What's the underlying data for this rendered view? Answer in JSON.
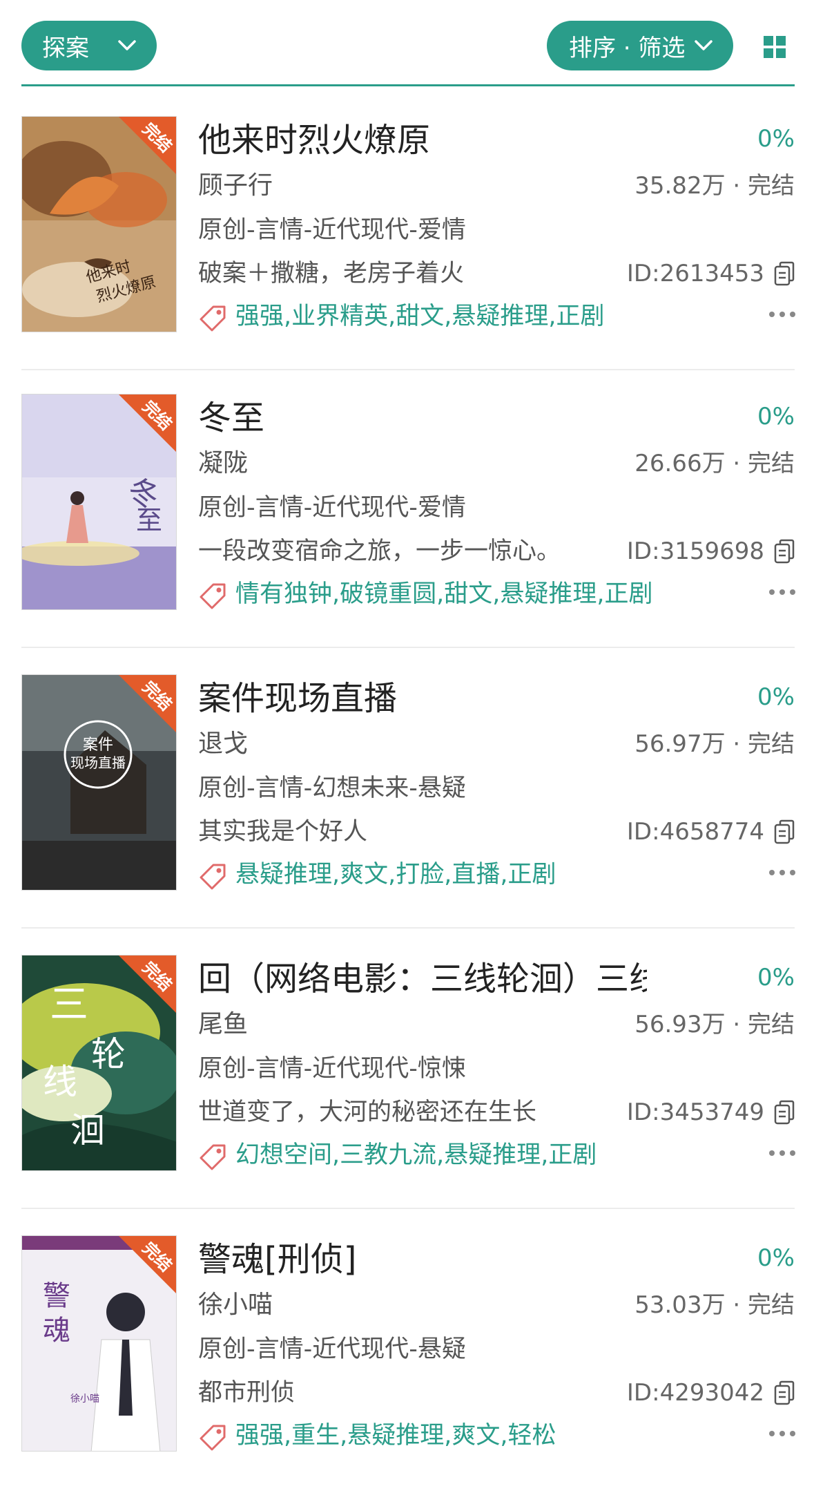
{
  "header": {
    "filter_label": "探案",
    "sort_label": "排序 · 筛选",
    "accent": "#2a9d8a"
  },
  "books": [
    {
      "badge": "完结",
      "title": "他来时烈火燎原",
      "progress": "0%",
      "author": "顾子行",
      "stats": "35.82万 · 完结",
      "category": "原创-言情-近代现代-爱情",
      "summary": "破案＋撒糖，老房子着火",
      "id_text": "ID:2613453",
      "tags": "强强,业界精英,甜文,悬疑推理,正剧"
    },
    {
      "badge": "完结",
      "title": "冬至",
      "progress": "0%",
      "author": "凝陇",
      "stats": "26.66万 · 完结",
      "category": "原创-言情-近代现代-爱情",
      "summary": "一段改变宿命之旅，一步一惊心。",
      "id_text": "ID:3159698",
      "tags": "情有独钟,破镜重圆,甜文,悬疑推理,正剧"
    },
    {
      "badge": "完结",
      "title": "案件现场直播",
      "progress": "0%",
      "author": "退戈",
      "stats": "56.97万 · 完结",
      "category": "原创-言情-幻想未来-悬疑",
      "summary": "其实我是个好人",
      "id_text": "ID:4658774",
      "tags": "悬疑推理,爽文,打脸,直播,正剧"
    },
    {
      "badge": "完结",
      "title": "回（网络电影：三线轮洄）三线轮洄",
      "progress": "0%",
      "author": "尾鱼",
      "stats": "56.93万 · 完结",
      "category": "原创-言情-近代现代-惊悚",
      "summary": "世道变了，大河的秘密还在生长",
      "id_text": "ID:3453749",
      "tags": "幻想空间,三教九流,悬疑推理,正剧"
    },
    {
      "badge": "完结",
      "title": "警魂[刑侦]",
      "progress": "0%",
      "author": "徐小喵",
      "stats": "53.03万 · 完结",
      "category": "原创-言情-近代现代-悬疑",
      "summary": "都市刑侦",
      "id_text": "ID:4293042",
      "tags": "强强,重生,悬疑推理,爽文,轻松"
    }
  ]
}
